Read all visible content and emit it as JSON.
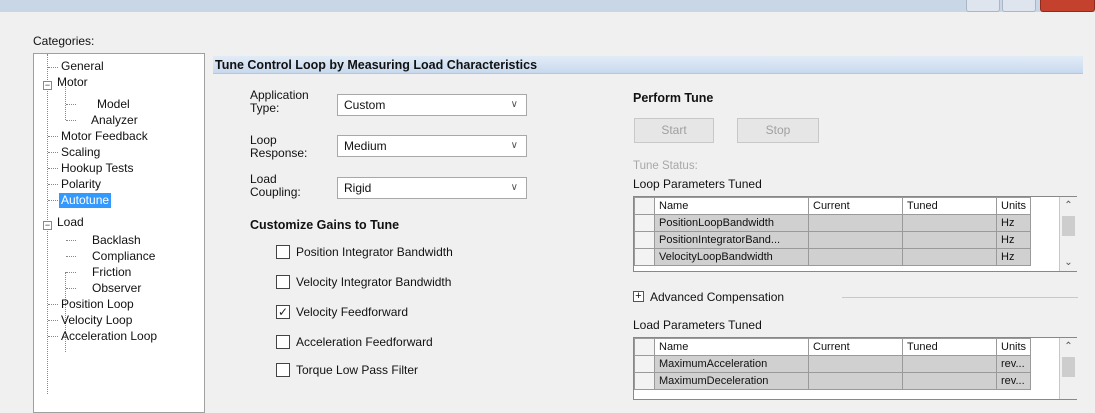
{
  "categories_label": "Categories:",
  "tree": [
    {
      "label": "General"
    },
    {
      "label": "Motor"
    },
    {
      "label": "Model"
    },
    {
      "label": "Analyzer"
    },
    {
      "label": "Motor Feedback"
    },
    {
      "label": "Scaling"
    },
    {
      "label": "Hookup Tests"
    },
    {
      "label": "Polarity"
    },
    {
      "label": "Autotune"
    },
    {
      "label": "Load"
    },
    {
      "label": "Backlash"
    },
    {
      "label": "Compliance"
    },
    {
      "label": "Friction"
    },
    {
      "label": "Observer"
    },
    {
      "label": "Position Loop"
    },
    {
      "label": "Velocity Loop"
    },
    {
      "label": "Acceleration Loop"
    }
  ],
  "header_title": "Tune Control Loop by Measuring Load Characteristics",
  "fields": {
    "application_type": {
      "label1": "Application",
      "label2": "Type:",
      "value": "Custom"
    },
    "loop_response": {
      "label1": "Loop",
      "label2": "Response:",
      "value": "Medium"
    },
    "load_coupling": {
      "label1": "Load",
      "label2": "Coupling:",
      "value": "Rigid"
    }
  },
  "customize_title": "Customize Gains to Tune",
  "gains": [
    {
      "label": "Position Integrator Bandwidth",
      "checked": ""
    },
    {
      "label": "Velocity Integrator Bandwidth",
      "checked": ""
    },
    {
      "label": "Velocity Feedforward",
      "checked": "✓"
    },
    {
      "label": "Acceleration Feedforward",
      "checked": ""
    },
    {
      "label": "Torque Low Pass Filter",
      "checked": ""
    }
  ],
  "perform_tune": {
    "title": "Perform Tune",
    "start_label": "Start",
    "stop_label": "Stop",
    "tune_status_label": "Tune Status:"
  },
  "loop_params": {
    "title": "Loop Parameters Tuned",
    "headers": [
      "Name",
      "Current",
      "Tuned",
      "Units"
    ],
    "rows": [
      [
        "PositionLoopBandwidth",
        "",
        "",
        "Hz"
      ],
      [
        "PositionIntegratorBand...",
        "",
        "",
        "Hz"
      ],
      [
        "VelocityLoopBandwidth",
        "",
        "",
        "Hz"
      ]
    ]
  },
  "advanced_compensation_label": "Advanced Compensation",
  "load_params": {
    "title": "Load Parameters Tuned",
    "headers": [
      "Name",
      "Current",
      "Tuned",
      "Units"
    ],
    "rows": [
      [
        "MaximumAcceleration",
        "",
        "",
        "rev..."
      ],
      [
        "MaximumDeceleration",
        "",
        "",
        "rev..."
      ]
    ]
  },
  "colors": {
    "selected": "#3399ff",
    "header_bg": "#c8d9ee",
    "close_button": "#c4412e"
  }
}
